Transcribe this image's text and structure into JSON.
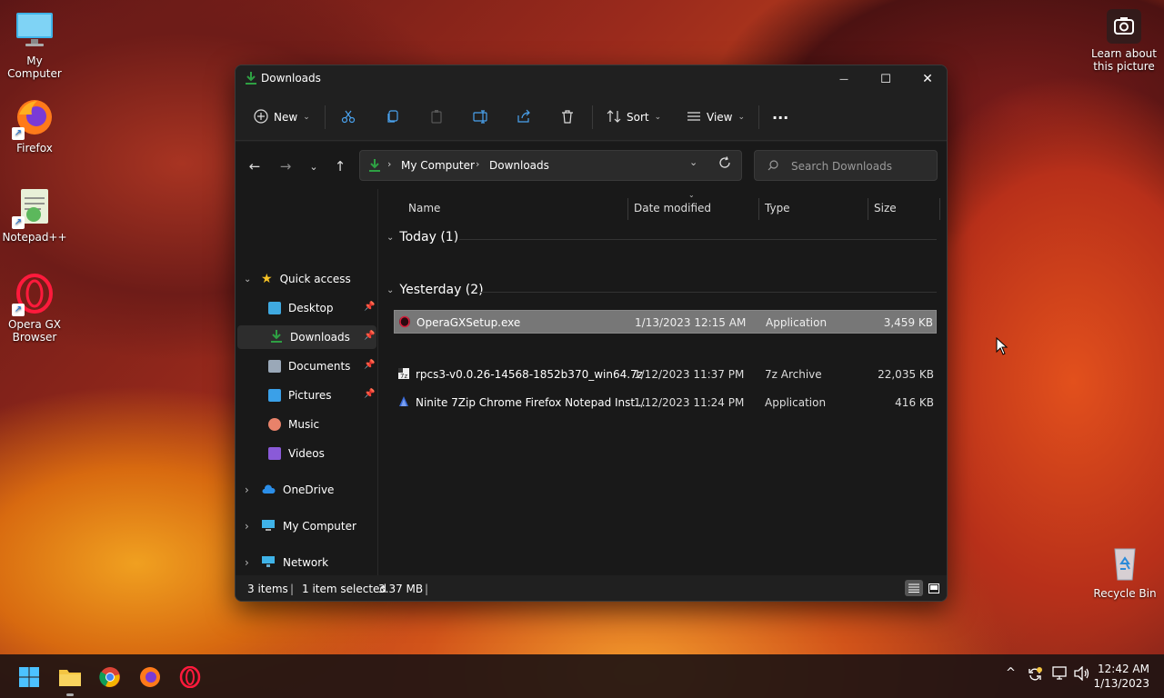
{
  "desktop": {
    "icons": [
      {
        "label": "My Computer",
        "icon": "monitor-icon"
      },
      {
        "label": "Firefox",
        "icon": "firefox-icon"
      },
      {
        "label": "Notepad++",
        "icon": "notepadpp-icon"
      },
      {
        "label": "Opera GX Browser",
        "icon": "opera-gx-icon"
      },
      {
        "label": "Recycle Bin",
        "icon": "recycle-bin-icon"
      }
    ],
    "learn_label_1": "Learn about",
    "learn_label_2": "this picture"
  },
  "window": {
    "title": "Downloads",
    "controls": {
      "minimize": "—",
      "maximize": "☐",
      "close": "✕"
    }
  },
  "toolbar": {
    "new_label": "New",
    "sort_label": "Sort",
    "view_label": "View",
    "more_label": "···"
  },
  "address": {
    "crumbs": [
      "My Computer",
      "Downloads"
    ],
    "search_placeholder": "Search Downloads"
  },
  "nav": {
    "quick_access": "Quick access",
    "items": [
      {
        "label": "Desktop",
        "pinned": true
      },
      {
        "label": "Downloads",
        "pinned": true,
        "selected": true
      },
      {
        "label": "Documents",
        "pinned": true
      },
      {
        "label": "Pictures",
        "pinned": true
      },
      {
        "label": "Music"
      },
      {
        "label": "Videos"
      }
    ],
    "onedrive": "OneDrive",
    "my_computer": "My Computer",
    "network": "Network"
  },
  "columns": [
    "Name",
    "Date modified",
    "Type",
    "Size"
  ],
  "groups": [
    {
      "label": "Today (1)",
      "files": [
        {
          "name": "OperaGXSetup.exe",
          "date": "1/13/2023 12:15 AM",
          "type": "Application",
          "size": "3,459 KB",
          "selected": true
        }
      ]
    },
    {
      "label": "Yesterday (2)",
      "files": [
        {
          "name": "rpcs3-v0.0.26-14568-1852b370_win64.7z",
          "date": "1/12/2023 11:37 PM",
          "type": "7z Archive",
          "size": "22,035 KB"
        },
        {
          "name": "Ninite 7Zip Chrome Firefox Notepad Inst...",
          "date": "1/12/2023 11:24 PM",
          "type": "Application",
          "size": "416 KB"
        }
      ]
    }
  ],
  "status": {
    "items": "3 items",
    "selected": "1 item selected",
    "size": "3.37 MB"
  },
  "taskbar": {
    "time": "12:42 AM",
    "date": "1/13/2023"
  },
  "colors": {
    "accent_green": "#2ea043",
    "selection": "#777777",
    "window_bg": "#191919"
  }
}
